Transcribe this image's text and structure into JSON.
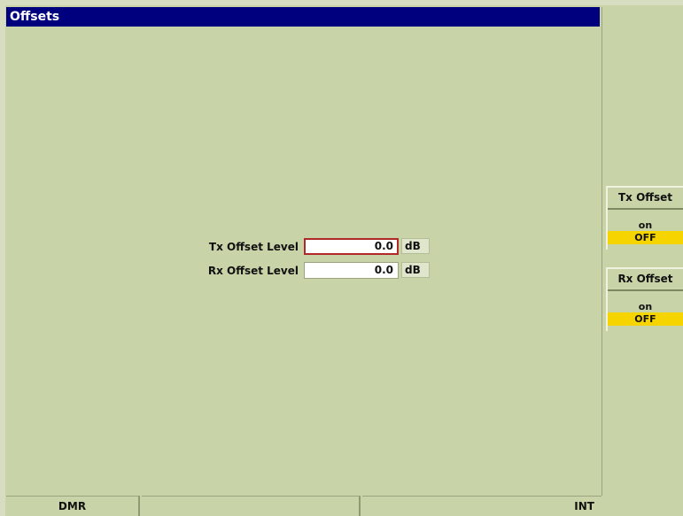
{
  "window": {
    "title": "Offsets"
  },
  "form": {
    "tx_offset_level": {
      "label": "Tx Offset Level",
      "value": "0.0",
      "unit": "dB"
    },
    "rx_offset_level": {
      "label": "Rx Offset Level",
      "value": "0.0",
      "unit": "dB"
    }
  },
  "softkeys": [
    {
      "title": "Tx Offset",
      "on_label": "on",
      "off_label": "OFF",
      "selected": "OFF"
    },
    {
      "title": "Rx Offset",
      "on_label": "on",
      "off_label": "OFF",
      "selected": "OFF"
    }
  ],
  "statusbar": {
    "mode": "DMR",
    "middle": "",
    "reference": "INT"
  },
  "colors": {
    "title_bar": "#00007e",
    "background": "#c8d4a8",
    "selected_highlight": "#f5d400",
    "focus_border": "#b12828"
  }
}
